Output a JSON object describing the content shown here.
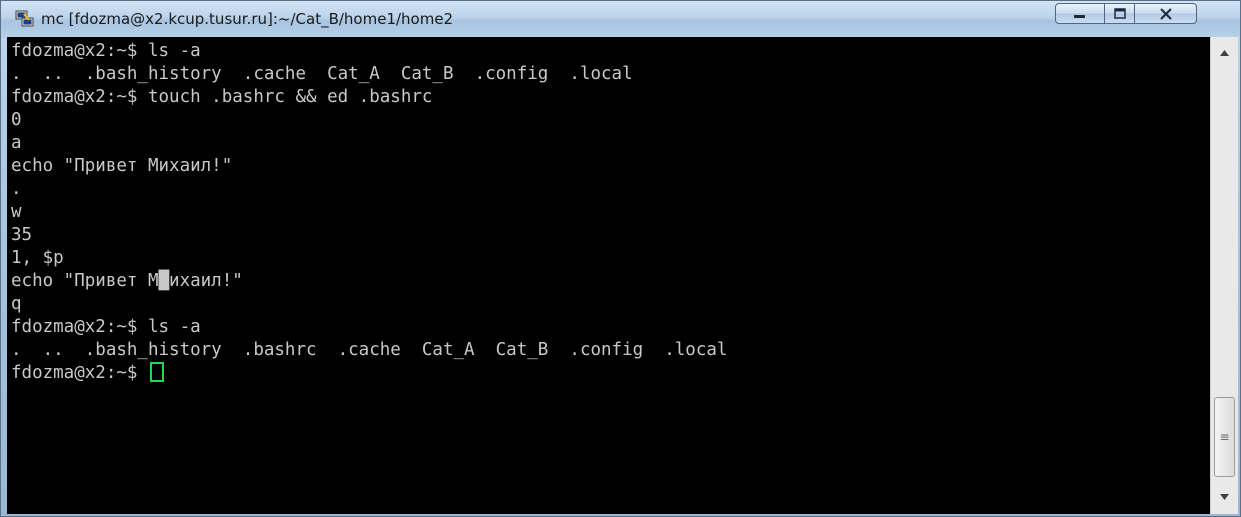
{
  "window": {
    "title": "mc [fdozma@x2.kcup.tusur.ru]:~/Cat_B/home1/home2",
    "icon": "putty-app-icon",
    "controls": [
      "minimize-icon",
      "maximize-icon",
      "close-icon"
    ]
  },
  "terminal": {
    "lines": [
      "fdozma@x2:~$ ls -a",
      ".  ..  .bash_history  .cache  Cat_A  Cat_B  .config  .local",
      "fdozma@x2:~$ touch .bashrc && ed .bashrc",
      "0",
      "a",
      "echo \"Привет Михаил!\"",
      ".",
      "w",
      "35",
      "1, $p",
      "echo \"Привет М█ихаил!\"",
      "q",
      "fdozma@x2:~$ ls -a",
      ".  ..  .bash_history  .bashrc  .cache  Cat_A  Cat_B  .config  .local",
      "fdozma@x2:~$ "
    ],
    "cursor_color": "#22d84a",
    "text_color": "#c8c8c8",
    "background": "#000000"
  },
  "scrollbar": {
    "up": "up-arrow-icon",
    "down": "down-arrow-icon"
  }
}
